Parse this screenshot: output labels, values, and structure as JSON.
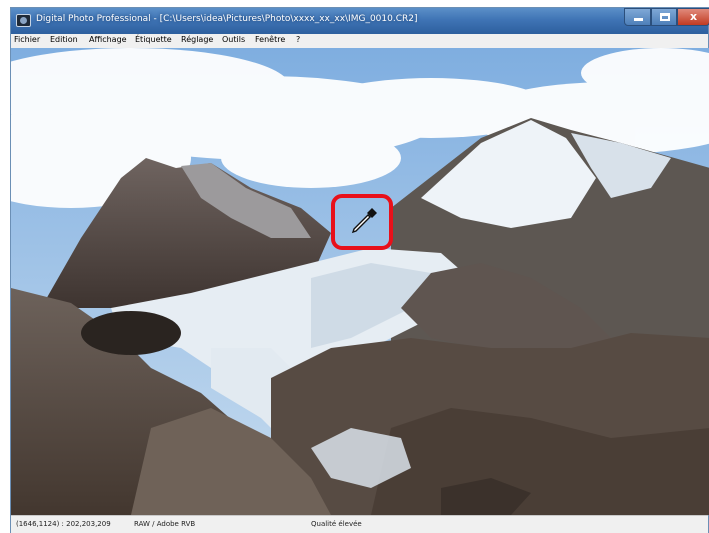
{
  "window": {
    "title": "Digital Photo Professional - [C:\\Users\\idea\\Pictures\\Photo\\xxxx_xx_xx\\IMG_0010.CR2]",
    "close_glyph": "x"
  },
  "menu": [
    {
      "label": "Fichier"
    },
    {
      "label": "Edition"
    },
    {
      "label": "Affichage"
    },
    {
      "label": "Étiquette"
    },
    {
      "label": "Réglage"
    },
    {
      "label": "Outils"
    },
    {
      "label": "Fenêtre"
    },
    {
      "label": "?"
    }
  ],
  "photo": {
    "icon": "eyedropper-icon",
    "highlight_color": "#e8101a"
  },
  "status": {
    "pixel_info": "(1646,1124) : 202,203,209",
    "format": "RAW / Adobe RVB",
    "quality": "Qualité élevée"
  }
}
